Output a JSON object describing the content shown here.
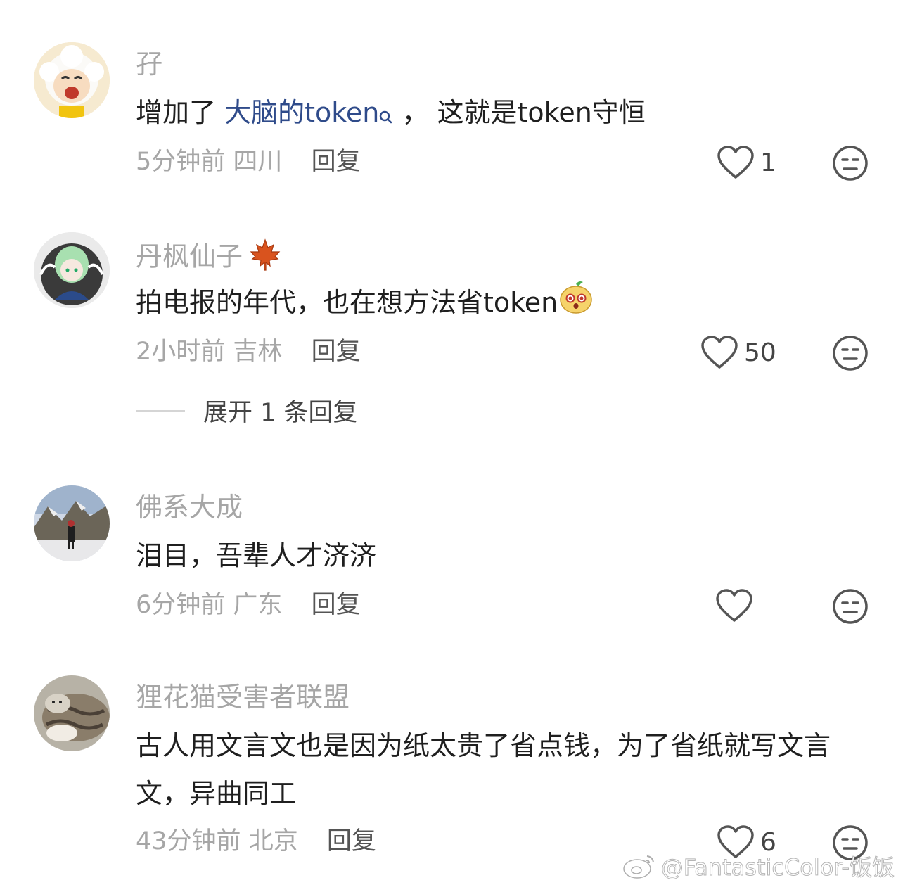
{
  "comments": [
    {
      "username": "孖",
      "content_prefix": "增加了 ",
      "content_highlight": "大脑的token",
      "content_suffix": " ， 这就是token守恒",
      "time": "5分钟前",
      "location": "四川",
      "reply_label": "回复",
      "likes": "1"
    },
    {
      "username": "丹枫仙子",
      "content": "拍电报的年代，也在想方法省token",
      "time": "2小时前",
      "location": "吉林",
      "reply_label": "回复",
      "likes": "50",
      "expand_label": "展开 1 条回复"
    },
    {
      "username": "佛系大成",
      "content": "泪目，吾辈人才济济",
      "time": "6分钟前",
      "location": "广东",
      "reply_label": "回复",
      "likes": ""
    },
    {
      "username": "狸花猫受害者联盟",
      "content": "古人用文言文也是因为纸太贵了省点钱，为了省纸就写文言文，异曲同工",
      "time": "43分钟前",
      "location": "北京",
      "reply_label": "回复",
      "likes": "6"
    }
  ],
  "watermark": "@FantasticColor-饭饭",
  "icons": {
    "like": "heart-outline-icon",
    "dislike": "meh-face-icon",
    "search_mark": "search-icon",
    "badge": "maple-leaf-icon",
    "emoji": "surprised-face-emoji",
    "watermark": "weibo-logo-icon"
  }
}
